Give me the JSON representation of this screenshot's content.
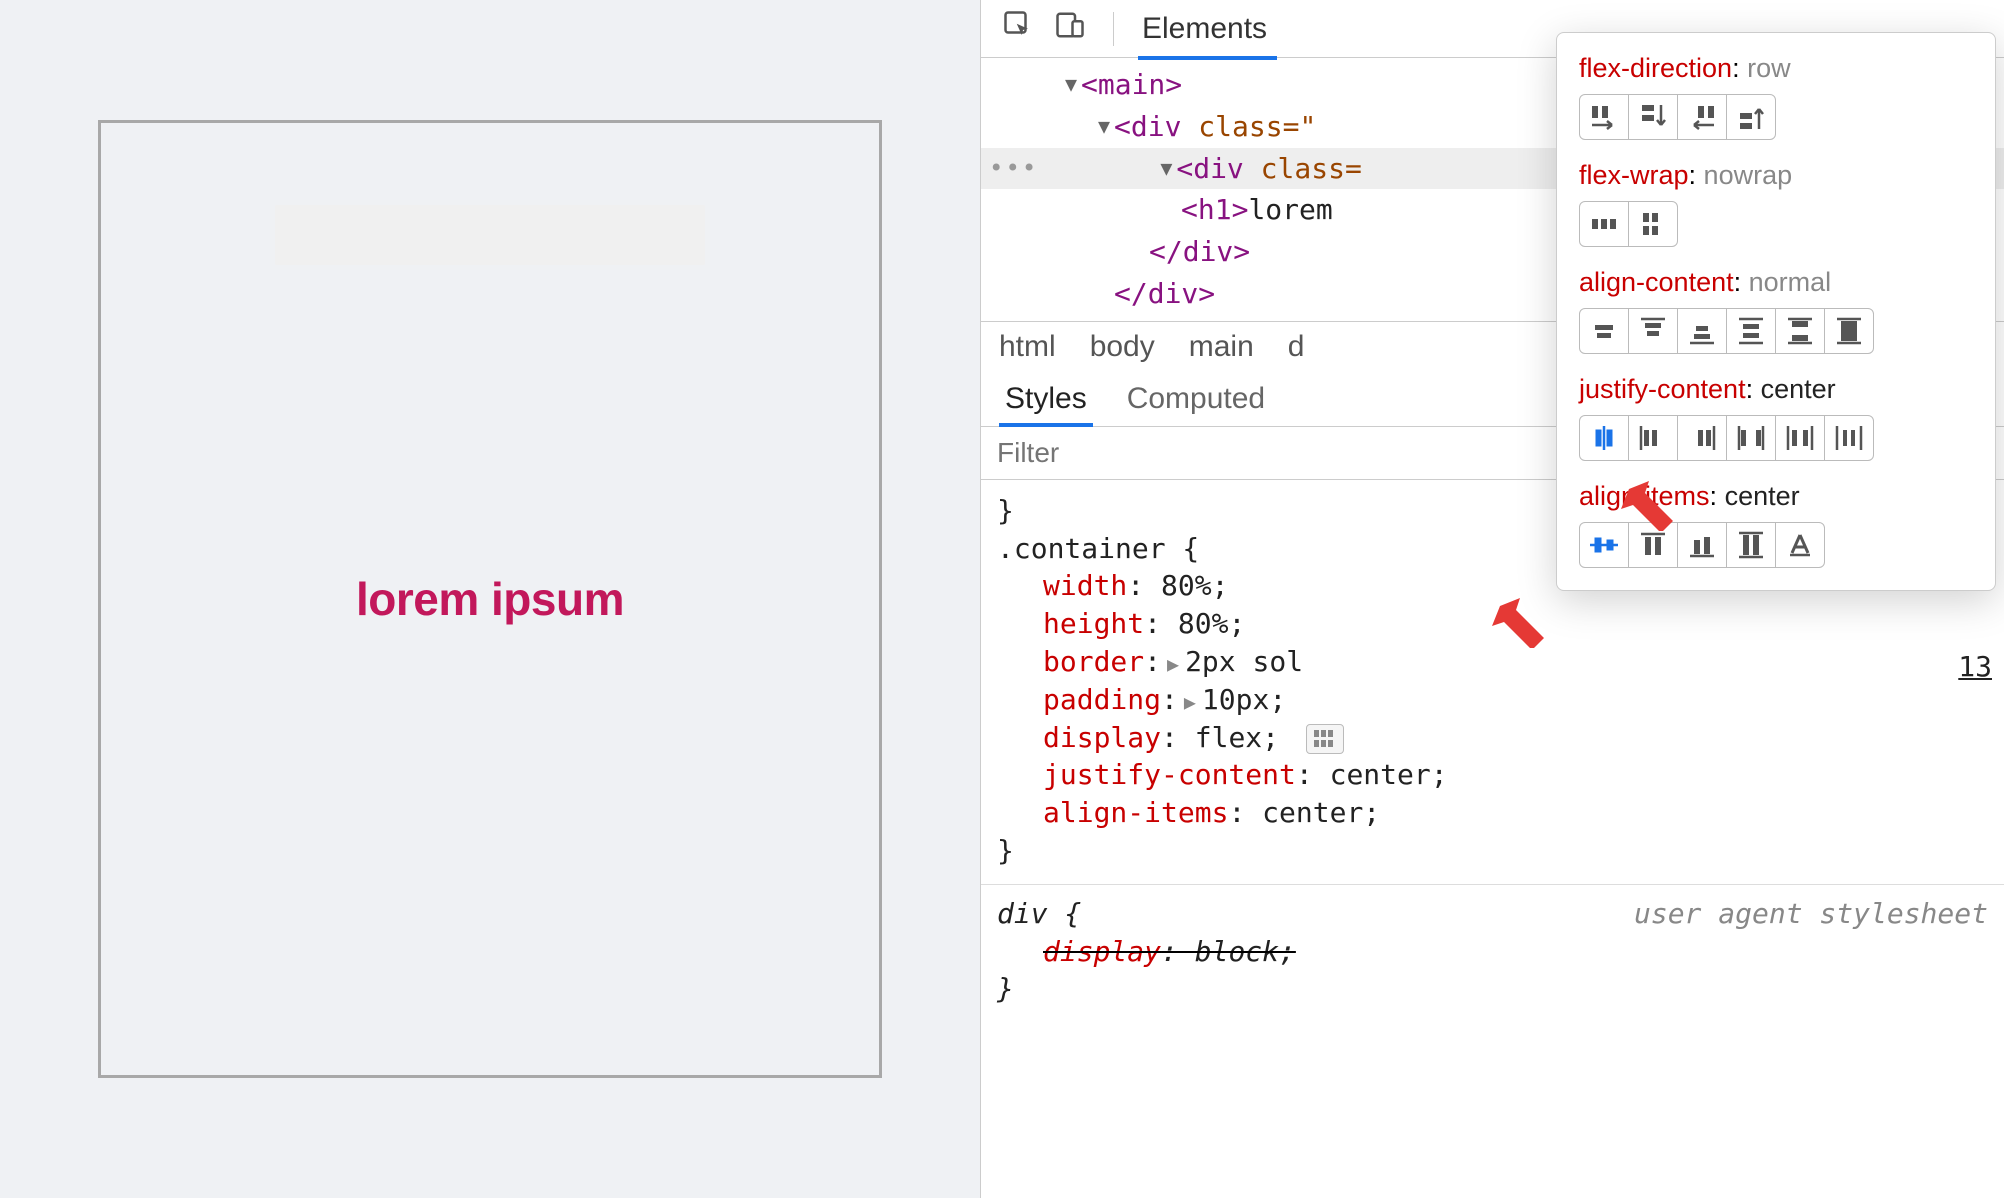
{
  "viewport": {
    "heading": "lorem ipsum"
  },
  "toolbar": {
    "tabs": [
      "Elements"
    ],
    "active_tab": "Elements"
  },
  "dom": {
    "main": "<main>",
    "div1": {
      "open": "<div",
      "cls": "class=\""
    },
    "div2": {
      "open": "<div",
      "cls": "class="
    },
    "h1": {
      "open": "<h1>",
      "text": "lorem"
    },
    "div2_close": "</div>",
    "div1_close": "</div>"
  },
  "breadcrumbs": [
    "html",
    "body",
    "main",
    "d"
  ],
  "styles_tabs": {
    "styles": "Styles",
    "computed": "Computed"
  },
  "filter_placeholder": "Filter",
  "rules": {
    "container": {
      "selector": ".container {",
      "width_prop": "width",
      "width_val": ": 80%;",
      "height_prop": "height",
      "height_val": ": 80%;",
      "border_prop": "border",
      "border_val": "2px sol",
      "padding_prop": "padding",
      "padding_val": "10px;",
      "display_prop": "display",
      "display_val": ": flex;",
      "jc_prop": "justify-content",
      "jc_val": ": center;",
      "ai_prop": "align-items",
      "ai_val": ": center;",
      "close": "}"
    },
    "div": {
      "selector": "div {",
      "ua": "user agent stylesheet",
      "display_prop": "display",
      "display_val": ": block;",
      "close": "}"
    }
  },
  "source_line": "13",
  "flex_popup": {
    "flex_direction": {
      "label": "flex-direction",
      "value": "row"
    },
    "flex_wrap": {
      "label": "flex-wrap",
      "value": "nowrap"
    },
    "align_content": {
      "label": "align-content",
      "value": "normal"
    },
    "justify_content": {
      "label": "justify-content",
      "value": "center"
    },
    "align_items": {
      "label": "align-items",
      "value": "center"
    }
  }
}
